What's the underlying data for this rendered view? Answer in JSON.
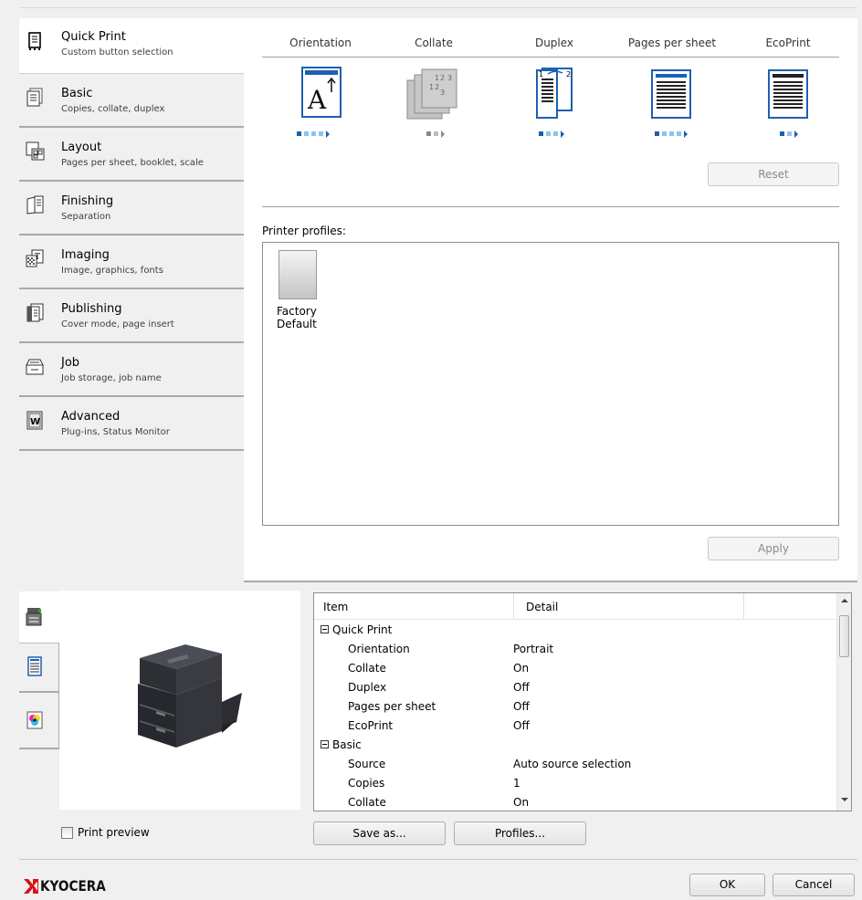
{
  "tabs": [
    {
      "title": "Quick Print",
      "subtitle": "Custom button selection",
      "icon": "quick-print-icon"
    },
    {
      "title": "Basic",
      "subtitle": "Copies, collate, duplex",
      "icon": "basic-icon"
    },
    {
      "title": "Layout",
      "subtitle": "Pages per sheet, booklet, scale",
      "icon": "layout-icon"
    },
    {
      "title": "Finishing",
      "subtitle": "Separation",
      "icon": "finishing-icon"
    },
    {
      "title": "Imaging",
      "subtitle": "Image, graphics, fonts",
      "icon": "imaging-icon"
    },
    {
      "title": "Publishing",
      "subtitle": "Cover mode, page insert",
      "icon": "publishing-icon"
    },
    {
      "title": "Job",
      "subtitle": "Job storage, job name",
      "icon": "job-icon"
    },
    {
      "title": "Advanced",
      "subtitle": "Plug-ins, Status Monitor",
      "icon": "advanced-icon"
    }
  ],
  "features": [
    {
      "label": "Orientation",
      "icon": "orientation-portrait-icon"
    },
    {
      "label": "Collate",
      "icon": "collate-icon"
    },
    {
      "label": "Duplex",
      "icon": "duplex-icon"
    },
    {
      "label": "Pages per sheet",
      "icon": "pages-per-sheet-icon"
    },
    {
      "label": "EcoPrint",
      "icon": "ecoprint-icon"
    }
  ],
  "reset_label": "Reset",
  "profiles_label": "Printer profiles:",
  "profile_item": {
    "line1": "Factory",
    "line2": "Default"
  },
  "apply_label": "Apply",
  "table": {
    "headers": [
      "Item",
      "Detail"
    ],
    "rows": [
      {
        "group": true,
        "item": "Quick Print",
        "detail": ""
      },
      {
        "group": false,
        "item": "Orientation",
        "detail": "Portrait"
      },
      {
        "group": false,
        "item": "Collate",
        "detail": "On"
      },
      {
        "group": false,
        "item": "Duplex",
        "detail": "Off"
      },
      {
        "group": false,
        "item": "Pages per sheet",
        "detail": "Off"
      },
      {
        "group": false,
        "item": "EcoPrint",
        "detail": "Off"
      },
      {
        "group": true,
        "item": "Basic",
        "detail": ""
      },
      {
        "group": false,
        "item": "Source",
        "detail": "Auto source selection"
      },
      {
        "group": false,
        "item": "Copies",
        "detail": "1"
      },
      {
        "group": false,
        "item": "Collate",
        "detail": "On"
      }
    ]
  },
  "print_preview_label": "Print preview",
  "save_as_label": "Save as...",
  "profiles_button_label": "Profiles...",
  "brand": "KYOCERA",
  "ok_label": "OK",
  "cancel_label": "Cancel",
  "colors": {
    "accent": "#1e5fb0",
    "brand": "#d7141a"
  }
}
